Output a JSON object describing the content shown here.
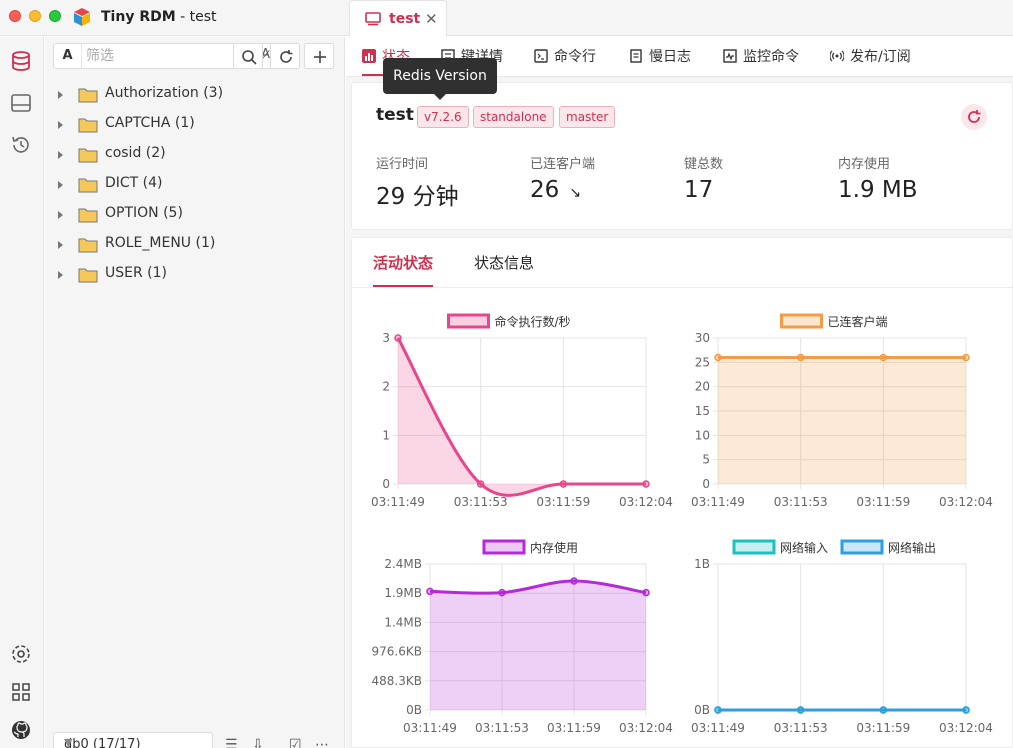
{
  "app": {
    "name": "Tiny RDM",
    "subtitle": " - test"
  },
  "window_tabs": [
    {
      "label": "test",
      "active": true
    }
  ],
  "sidebar": {
    "filter_type": "A",
    "filter_placeholder": "筛选",
    "filter_fuzzy": "A̷",
    "tree": [
      {
        "label": "Authorization (3)"
      },
      {
        "label": "CAPTCHA (1)"
      },
      {
        "label": "cosid (2)"
      },
      {
        "label": "DICT (4)"
      },
      {
        "label": "OPTION (5)"
      },
      {
        "label": "ROLE_MENU (1)"
      },
      {
        "label": "USER (1)"
      }
    ],
    "db_select": "db0 (17/17)"
  },
  "subtabs": [
    {
      "label": "状态",
      "icon": "status-icon"
    },
    {
      "label": "键详情",
      "icon": "key-detail-icon"
    },
    {
      "label": "命令行",
      "icon": "terminal-icon"
    },
    {
      "label": "慢日志",
      "icon": "slowlog-icon"
    },
    {
      "label": "监控命令",
      "icon": "monitor-icon"
    },
    {
      "label": "发布/订阅",
      "icon": "pubsub-icon"
    }
  ],
  "tooltip": "Redis Version",
  "server": {
    "name": "test",
    "tags": [
      "v7.2.6",
      "standalone",
      "master"
    ],
    "stats": [
      {
        "label": "运行时间",
        "value": "29 分钟"
      },
      {
        "label": "已连客户端",
        "value": "26",
        "extra": "↘"
      },
      {
        "label": "键总数",
        "value": "17"
      },
      {
        "label": "内存使用",
        "value": "1.9 MB"
      }
    ]
  },
  "inner_tabs": [
    {
      "label": "活动状态",
      "active": true
    },
    {
      "label": "状态信息",
      "active": false
    }
  ],
  "colors": {
    "accent": "#d03050",
    "pink": "#e8458b",
    "orange": "#f39c45",
    "purple": "#b32ad8",
    "teal": "#1ebfbf",
    "blue": "#2d9ee0"
  },
  "chart_data": [
    {
      "type": "line",
      "x": [
        "03:11:49",
        "03:11:53",
        "03:11:59",
        "03:12:04"
      ],
      "series": [
        {
          "name": "命令执行数/秒",
          "values": [
            3,
            0,
            0,
            0
          ],
          "color": "#e8458b"
        }
      ],
      "yticks": [
        "3",
        "2",
        "1",
        "0"
      ],
      "ylim": [
        0,
        3
      ]
    },
    {
      "type": "line",
      "x": [
        "03:11:49",
        "03:11:53",
        "03:11:59",
        "03:12:04"
      ],
      "series": [
        {
          "name": "已连客户端",
          "values": [
            26,
            26,
            26,
            26
          ],
          "color": "#f39c45"
        }
      ],
      "yticks": [
        "30",
        "25",
        "20",
        "15",
        "10",
        "5",
        "0"
      ],
      "ylim": [
        0,
        30
      ]
    },
    {
      "type": "line",
      "x": [
        "03:11:49",
        "03:11:53",
        "03:11:59",
        "03:12:04"
      ],
      "series": [
        {
          "name": "内存使用",
          "values": [
            1.95,
            1.93,
            2.12,
            1.93
          ],
          "color": "#b32ad8"
        }
      ],
      "yticks": [
        "2.4MB",
        "1.9MB",
        "1.4MB",
        "976.6KB",
        "488.3KB",
        "0B"
      ],
      "ylim": [
        0,
        2.4
      ]
    },
    {
      "type": "line",
      "x": [
        "03:11:49",
        "03:11:53",
        "03:11:59",
        "03:12:04"
      ],
      "series": [
        {
          "name": "网络输入",
          "values": [
            0,
            0,
            0,
            0
          ],
          "color": "#1ebfbf"
        },
        {
          "name": "网络输出",
          "values": [
            0,
            0,
            0,
            0
          ],
          "color": "#2d9ee0"
        }
      ],
      "yticks": [
        "1B",
        "0B"
      ],
      "ylim": [
        0,
        1
      ]
    }
  ]
}
